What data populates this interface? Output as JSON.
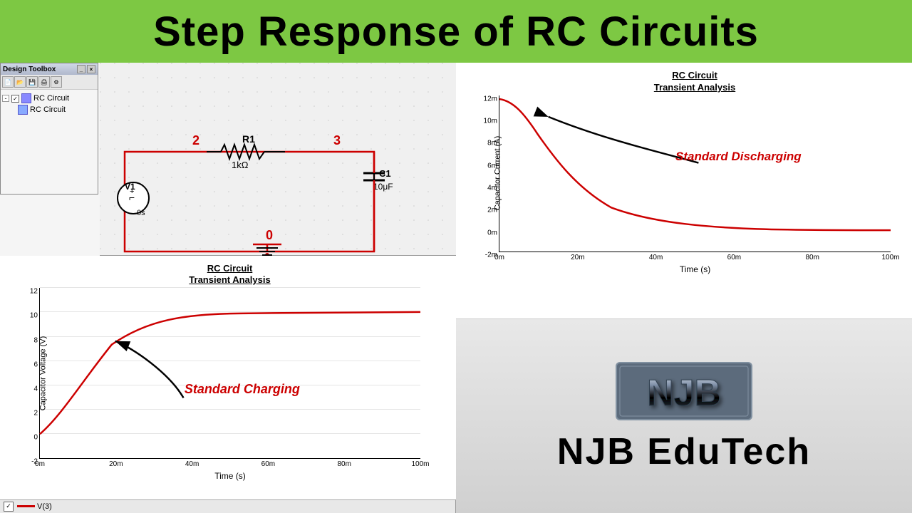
{
  "header": {
    "title": "Step Response of RC Circuits",
    "background_color": "#7dc843"
  },
  "toolbox": {
    "title": "Design Toolbox",
    "tree": {
      "root": "RC Circuit",
      "child": "RC Circuit"
    }
  },
  "schematic": {
    "nodes": {
      "node2": "2",
      "node3": "3",
      "node0": "0"
    },
    "components": {
      "V1": "V1",
      "R1": "R1",
      "R1_value": "1kΩ",
      "C1": "C1",
      "C1_value": "10μF",
      "time": "0s"
    }
  },
  "charging_graph": {
    "title_line1": "RC Circuit",
    "title_line2": "Transient Analysis",
    "y_axis_label": "Capacitor Voltage (V)",
    "x_axis_label": "Time (s)",
    "annotation": "Standard Charging",
    "y_ticks": [
      "12",
      "10",
      "8",
      "6",
      "4",
      "2",
      "0",
      "-2"
    ],
    "x_ticks": [
      "0m",
      "20m",
      "40m",
      "60m",
      "80m",
      "100m"
    ]
  },
  "discharging_graph": {
    "title_line1": "RC Circuit",
    "title_line2": "Transient Analysis",
    "y_axis_label": "Capacitor Current (A)",
    "x_axis_label": "Time (s)",
    "annotation": "Standard Discharging",
    "y_ticks": [
      "12m",
      "10m",
      "8m",
      "6m",
      "4m",
      "2m",
      "0m",
      "-2m"
    ],
    "x_ticks": [
      "0m",
      "20m",
      "40m",
      "60m",
      "80m",
      "100m"
    ]
  },
  "njb": {
    "logo_text": "NJB",
    "brand_text": "NJB EduTech"
  },
  "bottom_bar": {
    "v3_label": "V(3)"
  }
}
